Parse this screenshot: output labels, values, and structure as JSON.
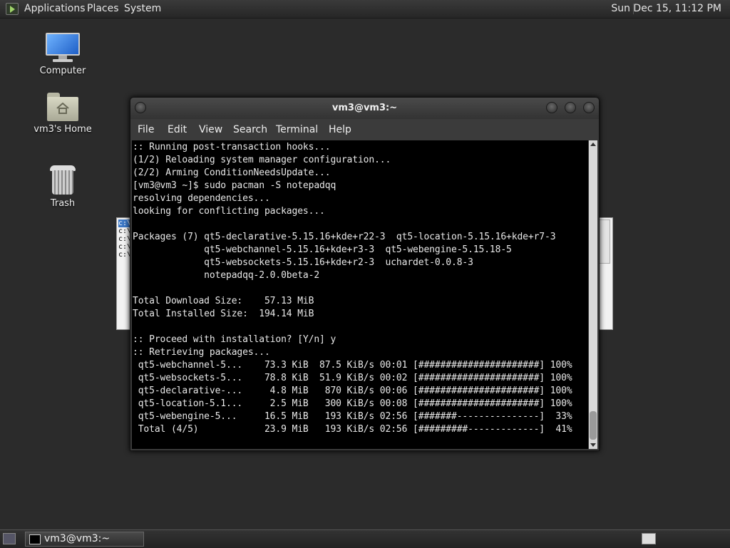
{
  "top_panel": {
    "menus": [
      "Applications",
      "Places",
      "System"
    ],
    "clock": "Sun Dec 15, 11:12 PM"
  },
  "desktop": {
    "icons": [
      {
        "label": "Computer",
        "icon": "computer-icon"
      },
      {
        "label": "vm3's Home",
        "icon": "home-folder-icon"
      },
      {
        "label": "Trash",
        "icon": "trash-icon"
      }
    ]
  },
  "background_window": {
    "lines": [
      "c:\\",
      "c:\\",
      "c:\\",
      "c:\\",
      "c:\\"
    ]
  },
  "terminal": {
    "title": "vm3@vm3:~",
    "menu": [
      "File",
      "Edit",
      "View",
      "Search",
      "Terminal",
      "Help"
    ],
    "lines": [
      ":: Running post-transaction hooks...",
      "(1/2) Reloading system manager configuration...",
      "(2/2) Arming ConditionNeedsUpdate...",
      "[vm3@vm3 ~]$ sudo pacman -S notepadqq",
      "resolving dependencies...",
      "looking for conflicting packages...",
      "",
      "Packages (7) qt5-declarative-5.15.16+kde+r22-3  qt5-location-5.15.16+kde+r7-3",
      "             qt5-webchannel-5.15.16+kde+r3-3  qt5-webengine-5.15.18-5",
      "             qt5-websockets-5.15.16+kde+r2-3  uchardet-0.0.8-3",
      "             notepadqq-2.0.0beta-2",
      "",
      "Total Download Size:    57.13 MiB",
      "Total Installed Size:  194.14 MiB",
      "",
      ":: Proceed with installation? [Y/n] y",
      ":: Retrieving packages...",
      " qt5-webchannel-5...    73.3 KiB  87.5 KiB/s 00:01 [######################] 100%",
      " qt5-websockets-5...    78.8 KiB  51.9 KiB/s 00:02 [######################] 100%",
      " qt5-declarative-...     4.8 MiB   870 KiB/s 00:06 [######################] 100%",
      " qt5-location-5.1...     2.5 MiB   300 KiB/s 00:08 [######################] 100%",
      " qt5-webengine-5...     16.5 MiB   193 KiB/s 02:56 [#######---------------]  33%",
      " Total (4/5)            23.9 MiB   193 KiB/s 02:56 [#########-------------]  41%"
    ]
  },
  "taskbar": {
    "items": [
      {
        "label": "vm3@vm3:~",
        "icon": "terminal-icon"
      }
    ]
  }
}
